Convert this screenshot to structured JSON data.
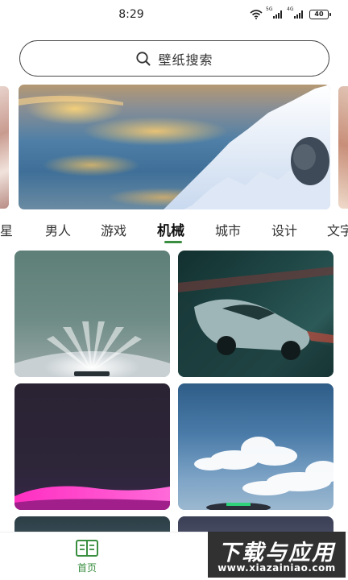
{
  "status_bar": {
    "time": "8:29",
    "battery": "40",
    "signal_labels": [
      "5G",
      "4G"
    ]
  },
  "search": {
    "placeholder": "壁纸搜索",
    "icon": "search-icon"
  },
  "tabs": {
    "items": [
      "明星",
      "男人",
      "游戏",
      "机械",
      "城市",
      "设计",
      "文字"
    ],
    "active": "机械",
    "accent_color": "#3a8e40"
  },
  "bottom_nav": {
    "home_label": "首页",
    "home_icon": "book-icon",
    "active_color": "#3a8e40"
  },
  "watermark": {
    "title": "下载与应用",
    "url": "www.xiazainiao.com"
  }
}
